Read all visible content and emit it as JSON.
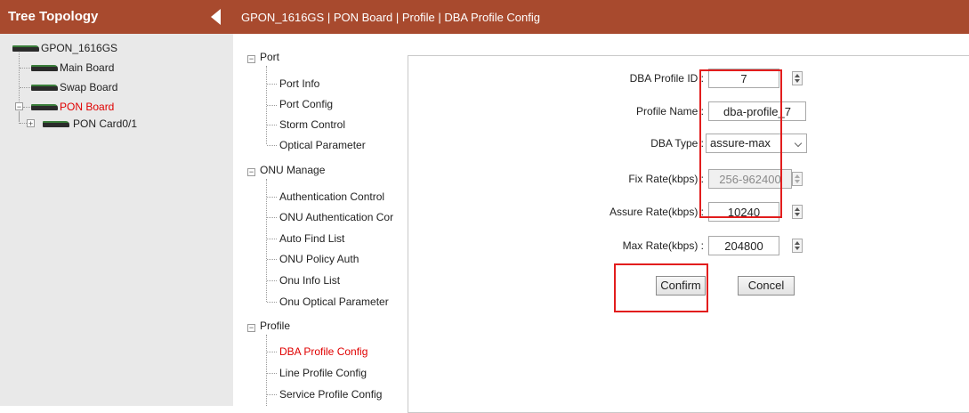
{
  "tree": {
    "title": "Tree Topology",
    "nodes": [
      {
        "label": "GPON_1616GS"
      },
      {
        "label": "Main Board"
      },
      {
        "label": "Swap Board"
      },
      {
        "label": "PON Board"
      },
      {
        "label": "PON Card0/1"
      }
    ]
  },
  "header": {
    "breadcrumb": "GPON_1616GS | PON Board | Profile | DBA Profile Config"
  },
  "menu": {
    "groups": [
      {
        "label": "Port",
        "items": [
          "Port Info",
          "Port Config",
          "Storm Control",
          "Optical Parameter"
        ]
      },
      {
        "label": "ONU Manage",
        "items": [
          "Authentication Control",
          "ONU Authentication Cor",
          "Auto Find List",
          "ONU Policy Auth",
          "Onu Info List",
          "Onu Optical Parameter"
        ]
      },
      {
        "label": "Profile",
        "items": [
          "DBA Profile Config",
          "Line Profile Config",
          "Service Profile Config"
        ]
      }
    ],
    "active_item": "DBA Profile Config"
  },
  "form": {
    "profile_id": {
      "label": "DBA Profile ID :",
      "value": "7"
    },
    "profile_name": {
      "label": "Profile Name :",
      "value": "dba-profile_7"
    },
    "dba_type": {
      "label": "DBA Type :",
      "value": "assure-max"
    },
    "fix_rate": {
      "label": "Fix Rate(kbps) :",
      "value": "256-962400"
    },
    "assure_rate": {
      "label": "Assure Rate(kbps) :",
      "value": "10240"
    },
    "max_rate": {
      "label": "Max Rate(kbps) :",
      "value": "204800"
    },
    "confirm_label": "Confirm",
    "cancel_label": "Concel"
  },
  "colors": {
    "header_bg": "#a84a2e",
    "highlight_red": "#e21d1d",
    "active_text": "#e00000"
  }
}
